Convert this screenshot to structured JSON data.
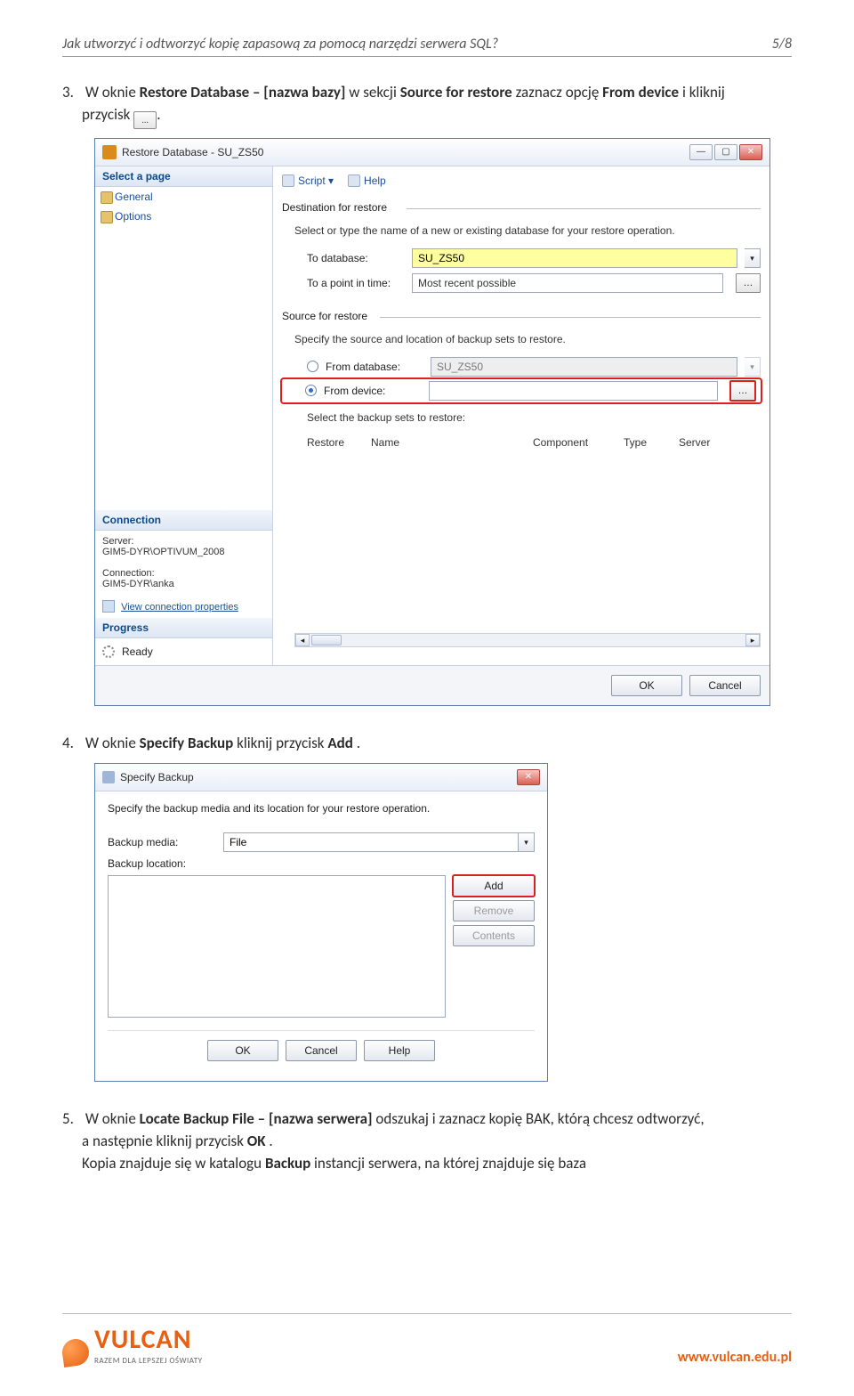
{
  "header": {
    "title": "Jak utworzyć i odtworzyć kopię zapasową za pomocą narzędzi serwera SQL?",
    "page": "5/8"
  },
  "step3": {
    "num": "3.",
    "t1": "W oknie ",
    "b1": "Restore Database – [nazwa bazy]",
    "t2": " w sekcji ",
    "b2": "Source for restore",
    "t3": " zaznacz opcję ",
    "b3": "From device",
    "t4": " i kliknij",
    "line2": "przycisk "
  },
  "restore": {
    "title": "Restore Database - SU_ZS50",
    "select_page": "Select a page",
    "general": "General",
    "options": "Options",
    "connection_hdr": "Connection",
    "server_lbl": "Server:",
    "server_val": "GIM5-DYR\\OPTIVUM_2008",
    "conn_lbl": "Connection:",
    "conn_val": "GIM5-DYR\\anka",
    "view_conn": "View connection properties",
    "progress_hdr": "Progress",
    "ready": "Ready",
    "script": "Script",
    "help": "Help",
    "grp_dest": "Destination for restore",
    "dest_hint": "Select or type the name of a new or existing database for your restore operation.",
    "to_db": "To database:",
    "to_db_val": "SU_ZS50",
    "to_time": "To a point in time:",
    "to_time_val": "Most recent possible",
    "grp_src": "Source for restore",
    "src_hint": "Specify the source and location of backup sets to restore.",
    "from_db": "From database:",
    "from_db_val": "SU_ZS50",
    "from_dev": "From device:",
    "sel_sets": "Select the backup sets to restore:",
    "col_restore": "Restore",
    "col_name": "Name",
    "col_component": "Component",
    "col_type": "Type",
    "col_server": "Server",
    "ok": "OK",
    "cancel": "Cancel"
  },
  "step4": {
    "num": "4.",
    "t1": "W oknie ",
    "b1": "Specify Backup",
    "t2": " kliknij przycisk ",
    "b2": "Add",
    "t3": "."
  },
  "specify": {
    "title": "Specify Backup",
    "hint": "Specify the backup media and its location for your restore operation.",
    "media_lbl": "Backup media:",
    "media_val": "File",
    "loc_lbl": "Backup location:",
    "add": "Add",
    "remove": "Remove",
    "contents": "Contents",
    "ok": "OK",
    "cancel": "Cancel",
    "help": "Help"
  },
  "step5": {
    "num": "5.",
    "t1": "W oknie ",
    "b1": "Locate Backup File – [nazwa serwera]",
    "t2": " odszukaj i zaznacz kopię BAK, którą chcesz odtworzyć,",
    "line2a": "a następnie kliknij przycisk ",
    "b2": "OK",
    "line2b": ".",
    "line3a": "Kopia znajduje się w katalogu ",
    "b3": "Backup",
    "line3b": " instancji serwera, na której znajduje się baza"
  },
  "footer": {
    "brand": "VULCAN",
    "tagline": "RAZEM DLA LEPSZEJ OŚWIATY",
    "site": "www.vulcan.edu.pl"
  }
}
